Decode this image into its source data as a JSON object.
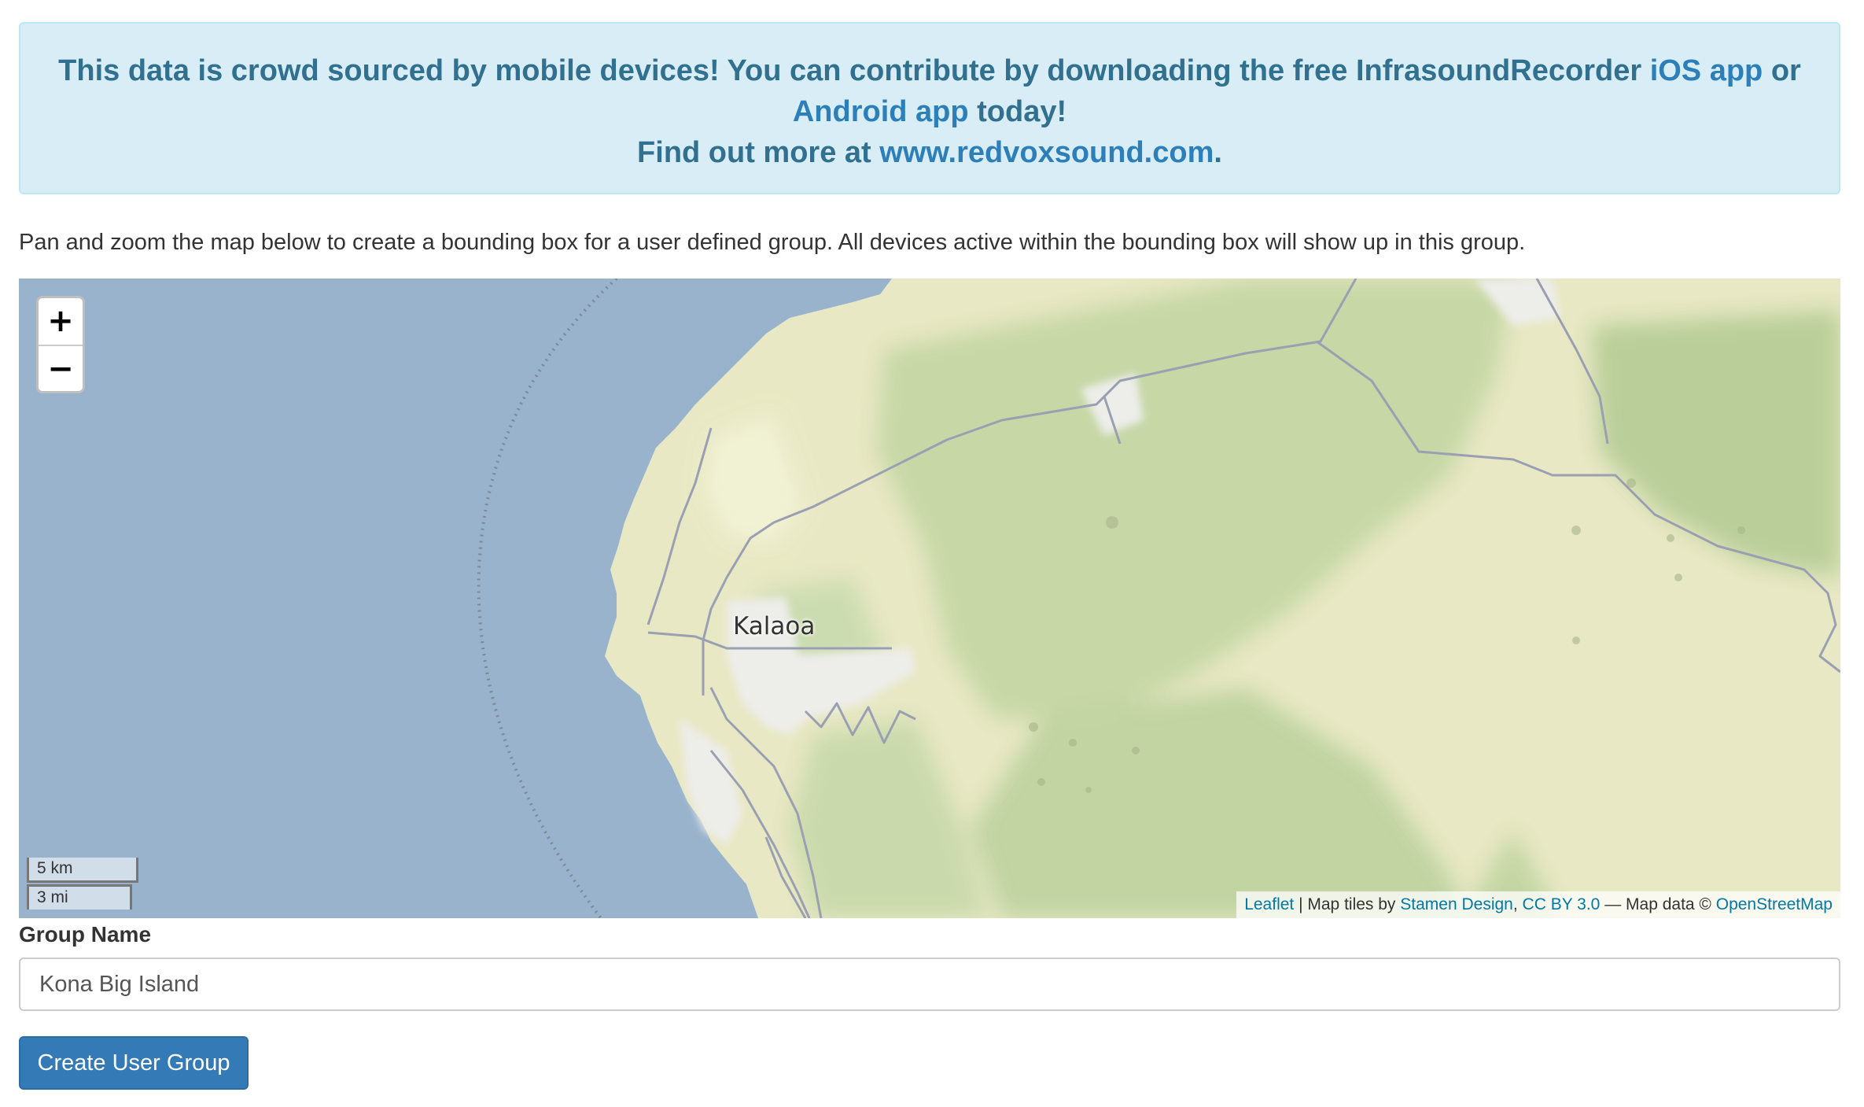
{
  "banner": {
    "part1": "This data is crowd sourced by mobile devices! You can contribute by downloading the free InfrasoundRecorder ",
    "ios_link": "iOS app",
    "part2": " or ",
    "android_link": "Android app",
    "part3": " today!",
    "line2_prefix": "Find out more at ",
    "site_link": "www.redvoxsound.com",
    "line2_suffix": "."
  },
  "intro_text": "Pan and zoom the map below to create a bounding box for a user defined group. All devices active within the bounding box will show up in this group.",
  "map": {
    "zoom_in_label": "+",
    "zoom_out_label": "−",
    "place_label": "Kalaoa",
    "scale_km": "5 km",
    "scale_mi": "3 mi",
    "attribution": {
      "leaflet": "Leaflet",
      "sep1": " | Map tiles by ",
      "stamen": "Stamen Design",
      "sep2": ", ",
      "license": "CC BY 3.0",
      "sep3": " — Map data © ",
      "osm": "OpenStreetMap"
    },
    "colors": {
      "water": "#99b3cc",
      "land": "#e8e8c4",
      "vegetation": "#c4d6a3",
      "urban": "#eeeeec",
      "roads": "#9a9fb0"
    }
  },
  "form": {
    "group_name_label": "Group Name",
    "group_name_value": "Kona Big Island",
    "submit_label": "Create User Group"
  },
  "colors": {
    "banner_bg": "#d9edf7",
    "banner_text": "#31708f",
    "link": "#2c7fb8",
    "button_bg": "#337ab7"
  }
}
